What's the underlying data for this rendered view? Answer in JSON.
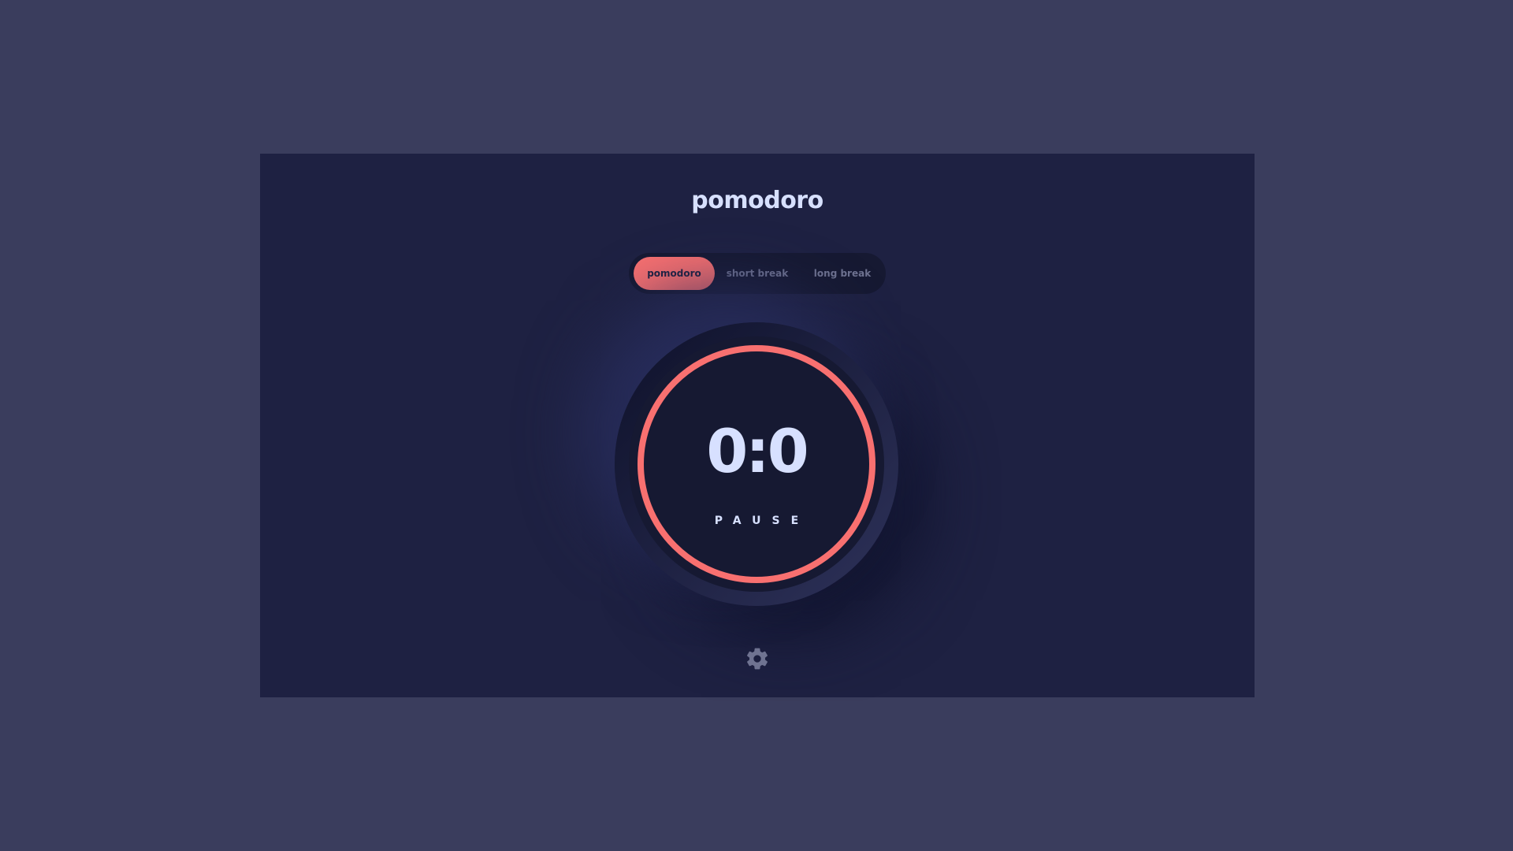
{
  "app": {
    "title": "pomodoro"
  },
  "modes": {
    "items": [
      {
        "label": "pomodoro",
        "active": true
      },
      {
        "label": "short break",
        "active": false
      },
      {
        "label": "long break",
        "active": false
      }
    ]
  },
  "timer": {
    "time": "0:0",
    "status": "PAUSE",
    "progress": 1.0
  },
  "settings": {
    "icon": "gear-icon"
  },
  "colors": {
    "accent": "#f87070",
    "page_background": "#3a3d5d",
    "app_background": "#1e2142",
    "text": "#d7e0ff",
    "muted": "#6f7391"
  }
}
